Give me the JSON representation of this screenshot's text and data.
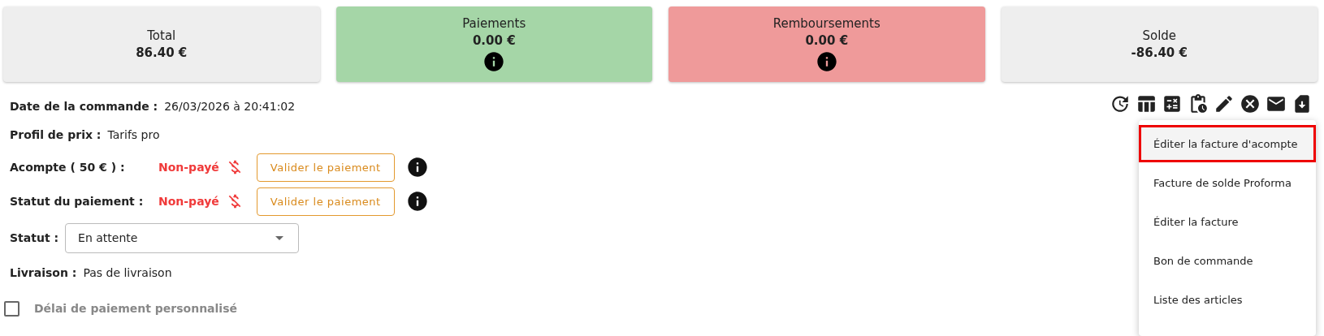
{
  "cards": [
    {
      "title": "Total",
      "amount": "86.40 €",
      "color": "#eeeeee",
      "info": false
    },
    {
      "title": "Paiements",
      "amount": "0.00 €",
      "color": "#a5d6a7",
      "info": true
    },
    {
      "title": "Remboursements",
      "amount": "0.00 €",
      "color": "#ef9a9a",
      "info": true
    },
    {
      "title": "Solde",
      "amount": "-86.40 €",
      "color": "#eeeeee",
      "info": false
    }
  ],
  "details": [
    {
      "kind": "text",
      "label": "Date de la commande :",
      "value": "26/03/2026 à 20:41:02"
    },
    {
      "kind": "text",
      "label": "Profil de prix :",
      "value": "Tarifs pro"
    },
    {
      "kind": "payment",
      "label": "Acompte ( 50 € ) :",
      "status": "Non-payé",
      "button": "Valider le paiement"
    },
    {
      "kind": "payment",
      "label": "Statut du paiement :",
      "status": "Non-payé",
      "button": "Valider le paiement"
    },
    {
      "kind": "select",
      "label": "Statut :",
      "value": "En attente"
    },
    {
      "kind": "text",
      "label": "Livraison :",
      "value": "Pas de livraison"
    },
    {
      "kind": "checkbox",
      "label": "Délai de paiement personnalisé",
      "checked": false,
      "disabled": true
    }
  ],
  "menu": [
    {
      "label": "Éditer la facture d'acompte",
      "selected": true
    },
    {
      "label": "Facture de solde Proforma",
      "selected": false
    },
    {
      "label": "Éditer la facture",
      "selected": false
    },
    {
      "label": "Bon de commande",
      "selected": false
    },
    {
      "label": "Liste des articles",
      "selected": false
    }
  ]
}
